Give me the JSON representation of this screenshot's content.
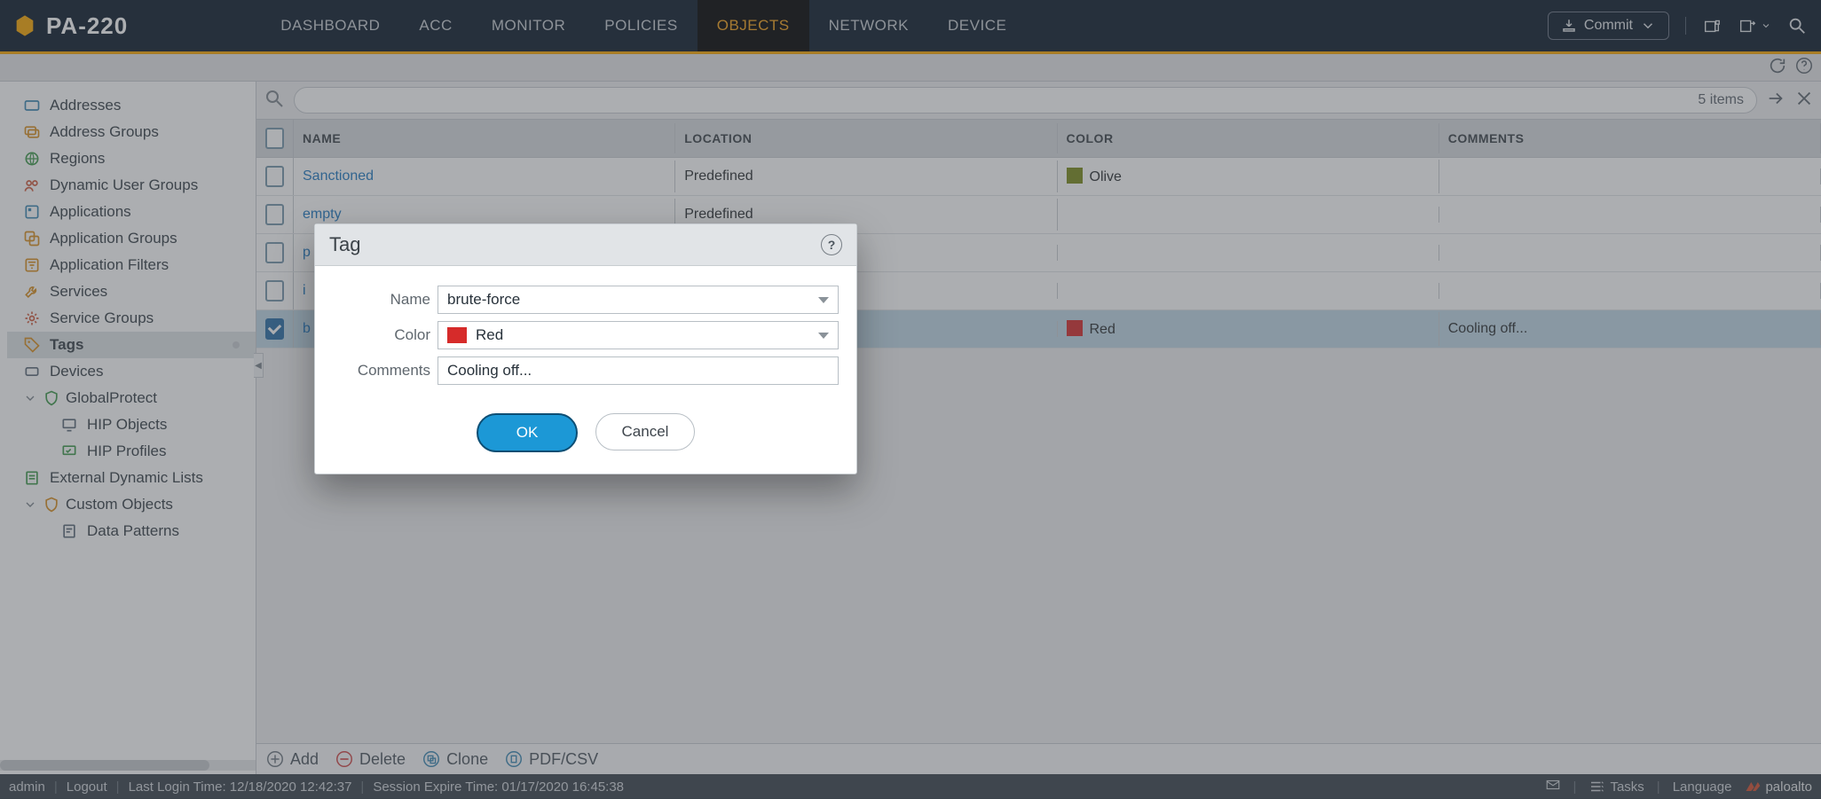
{
  "brand": "PA-220",
  "nav": {
    "tabs": [
      "DASHBOARD",
      "ACC",
      "MONITOR",
      "POLICIES",
      "OBJECTS",
      "NETWORK",
      "DEVICE"
    ],
    "active": "OBJECTS",
    "commit": "Commit"
  },
  "sidebar": {
    "items": [
      {
        "label": "Addresses"
      },
      {
        "label": "Address Groups"
      },
      {
        "label": "Regions"
      },
      {
        "label": "Dynamic User Groups"
      },
      {
        "label": "Applications"
      },
      {
        "label": "Application Groups"
      },
      {
        "label": "Application Filters"
      },
      {
        "label": "Services"
      },
      {
        "label": "Service Groups"
      },
      {
        "label": "Tags",
        "active": true
      },
      {
        "label": "Devices"
      },
      {
        "label": "GlobalProtect",
        "expandable": true,
        "expanded": true,
        "children": [
          {
            "label": "HIP Objects"
          },
          {
            "label": "HIP Profiles"
          }
        ]
      },
      {
        "label": "External Dynamic Lists"
      },
      {
        "label": "Custom Objects",
        "expandable": true,
        "expanded": true,
        "children": [
          {
            "label": "Data Patterns"
          }
        ]
      }
    ]
  },
  "search": {
    "count_text": "5 items"
  },
  "table": {
    "columns": [
      "NAME",
      "LOCATION",
      "COLOR",
      "COMMENTS"
    ],
    "rows": [
      {
        "checked": false,
        "name": "Sanctioned",
        "location": "Predefined",
        "color": "Olive",
        "color_hex": "#7a8b1b",
        "comments": ""
      },
      {
        "checked": false,
        "name": "empty",
        "location": "Predefined",
        "color": "",
        "color_hex": "",
        "comments": ""
      },
      {
        "checked": false,
        "name": "p",
        "location": "",
        "color": "",
        "color_hex": "",
        "comments": ""
      },
      {
        "checked": false,
        "name": "i",
        "location": "",
        "color": "",
        "color_hex": "",
        "comments": ""
      },
      {
        "checked": true,
        "name": "b",
        "location": "",
        "color": "Red",
        "color_hex": "#d62b2a",
        "comments": "Cooling off..."
      }
    ]
  },
  "ops": {
    "add": "Add",
    "delete": "Delete",
    "clone": "Clone",
    "pdfcsv": "PDF/CSV"
  },
  "dialog": {
    "title": "Tag",
    "labels": {
      "name": "Name",
      "color": "Color",
      "comments": "Comments"
    },
    "values": {
      "name": "brute-force",
      "color": "Red",
      "comments": "Cooling off..."
    },
    "color_hex": "#d62b2a",
    "ok": "OK",
    "cancel": "Cancel"
  },
  "statusbar": {
    "user": "admin",
    "logout": "Logout",
    "last_login": "Last Login Time: 12/18/2020 12:42:37",
    "session": "Session Expire Time: 01/17/2020 16:45:38",
    "tasks": "Tasks",
    "language": "Language",
    "vendor": "paloalto"
  }
}
